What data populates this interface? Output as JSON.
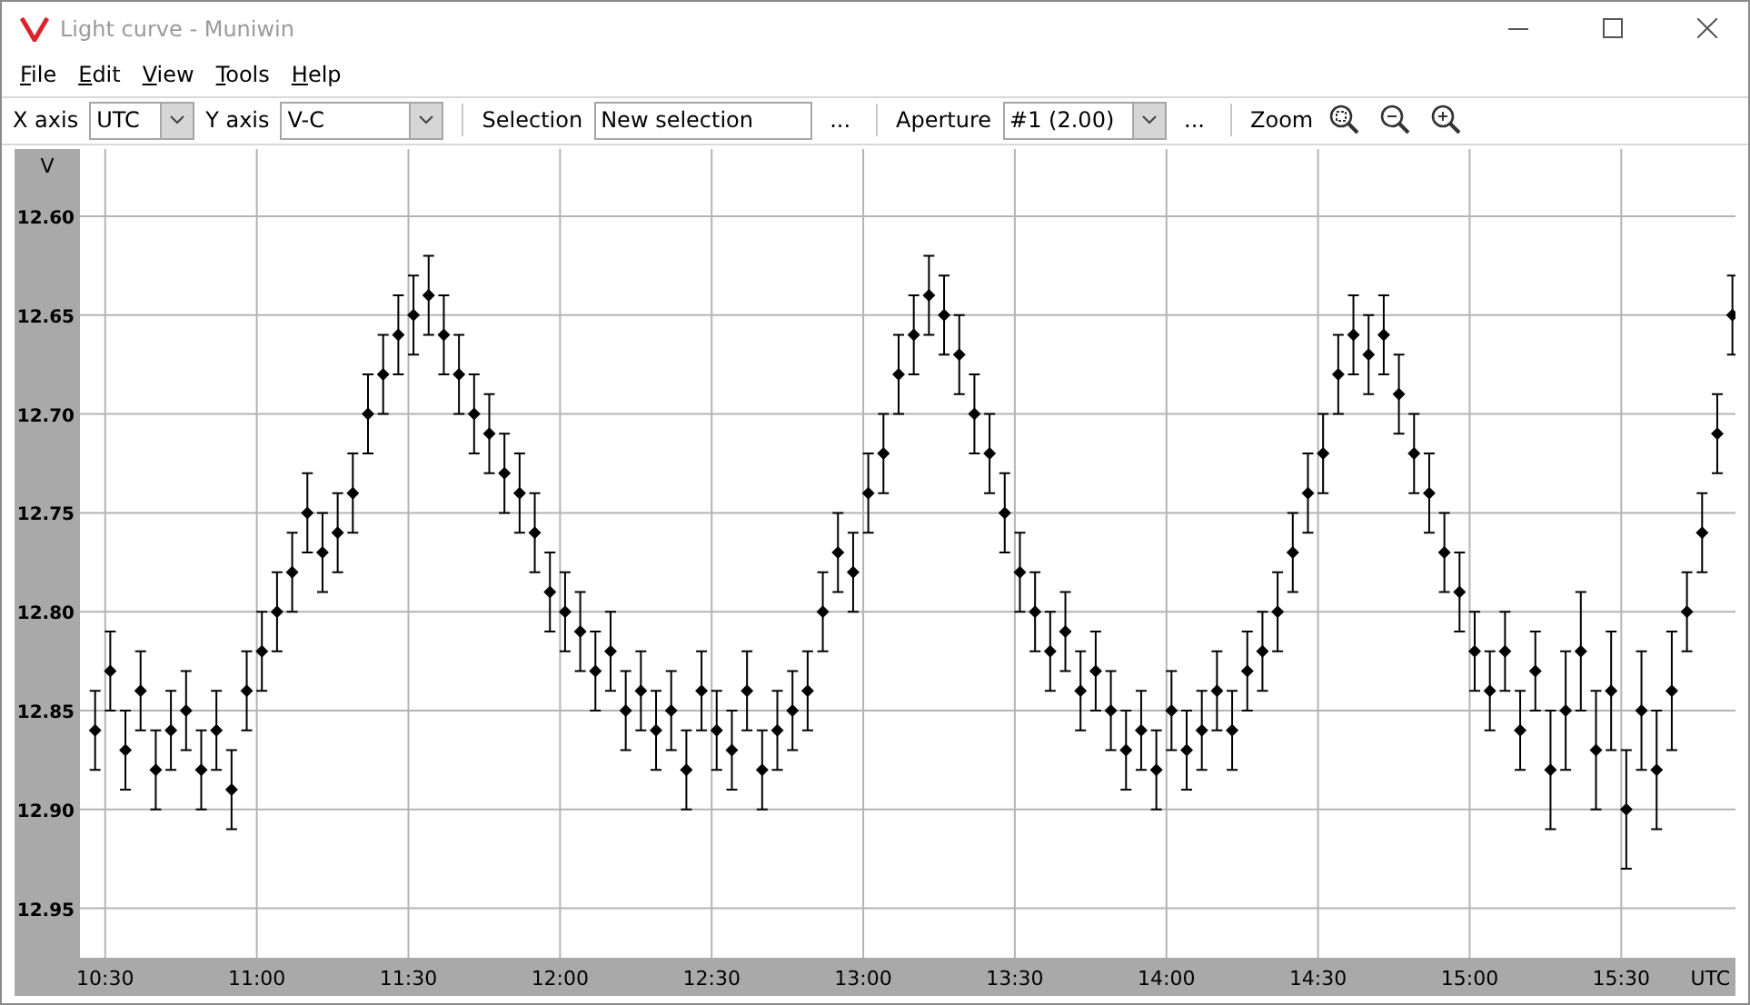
{
  "window": {
    "title": "Light curve - Muniwin"
  },
  "menu": [
    {
      "label": "File"
    },
    {
      "label": "Edit"
    },
    {
      "label": "View"
    },
    {
      "label": "Tools"
    },
    {
      "label": "Help"
    }
  ],
  "toolbar": {
    "x_axis": {
      "label": "X axis",
      "value": "UTC"
    },
    "y_axis": {
      "label": "Y axis",
      "value": "V-C"
    },
    "selection": {
      "label": "Selection",
      "value": "New selection",
      "more": "..."
    },
    "aperture": {
      "label": "Aperture",
      "value": "#1 (2.00)",
      "more": "..."
    },
    "zoom": {
      "label": "Zoom"
    }
  },
  "chart": {
    "chart_data": {
      "type": "scatter",
      "xlabel": "UTC",
      "ylabel": "V",
      "x": [
        628,
        631,
        634,
        637,
        640,
        643,
        646,
        649,
        652,
        655,
        658,
        661,
        664,
        667,
        670,
        673,
        676,
        679,
        682,
        685,
        688,
        691,
        694,
        697,
        700,
        703,
        706,
        709,
        712,
        715,
        718,
        721,
        724,
        727,
        730,
        733,
        736,
        739,
        742,
        745,
        748,
        751,
        754,
        757,
        760,
        763,
        766,
        769,
        772,
        775,
        778,
        781,
        784,
        787,
        790,
        793,
        796,
        799,
        802,
        805,
        808,
        811,
        814,
        817,
        820,
        823,
        826,
        829,
        832,
        835,
        838,
        841,
        844,
        847,
        850,
        853,
        856,
        859,
        862,
        865,
        868,
        871,
        874,
        877,
        880,
        883,
        886,
        889,
        892,
        895,
        898,
        901,
        904,
        907,
        910,
        913,
        916,
        919,
        922,
        925,
        928,
        931,
        934,
        937,
        940,
        943,
        946,
        949,
        952
      ],
      "grid": true,
      "series": [
        {
          "color": "#000000",
          "errors": [
            0.02,
            0.02,
            0.02,
            0.02,
            0.02,
            0.02,
            0.02,
            0.02,
            0.02,
            0.02,
            0.02,
            0.02,
            0.02,
            0.02,
            0.02,
            0.02,
            0.02,
            0.02,
            0.02,
            0.02,
            0.02,
            0.02,
            0.02,
            0.02,
            0.02,
            0.02,
            0.02,
            0.02,
            0.02,
            0.02,
            0.02,
            0.02,
            0.02,
            0.02,
            0.02,
            0.02,
            0.02,
            0.02,
            0.02,
            0.02,
            0.02,
            0.02,
            0.02,
            0.02,
            0.02,
            0.02,
            0.02,
            0.02,
            0.02,
            0.02,
            0.02,
            0.02,
            0.02,
            0.02,
            0.02,
            0.02,
            0.02,
            0.02,
            0.02,
            0.02,
            0.02,
            0.02,
            0.02,
            0.02,
            0.02,
            0.02,
            0.02,
            0.02,
            0.02,
            0.02,
            0.02,
            0.02,
            0.02,
            0.02,
            0.02,
            0.02,
            0.02,
            0.02,
            0.02,
            0.02,
            0.02,
            0.02,
            0.02,
            0.02,
            0.02,
            0.02,
            0.02,
            0.02,
            0.02,
            0.02,
            0.02,
            0.02,
            0.02,
            0.02,
            0.02,
            0.02,
            0.03,
            0.03,
            0.03,
            0.03,
            0.03,
            0.03,
            0.03,
            0.03,
            0.03,
            0.02,
            0.02,
            0.02,
            0.02
          ],
          "values": [
            12.86,
            12.83,
            12.87,
            12.84,
            12.88,
            12.86,
            12.85,
            12.88,
            12.86,
            12.89,
            12.84,
            12.82,
            12.8,
            12.78,
            12.75,
            12.77,
            12.76,
            12.74,
            12.7,
            12.68,
            12.66,
            12.65,
            12.64,
            12.66,
            12.68,
            12.7,
            12.71,
            12.73,
            12.74,
            12.76,
            12.79,
            12.8,
            12.81,
            12.83,
            12.82,
            12.85,
            12.84,
            12.86,
            12.85,
            12.88,
            12.84,
            12.86,
            12.87,
            12.84,
            12.88,
            12.86,
            12.85,
            12.84,
            12.8,
            12.77,
            12.78,
            12.74,
            12.72,
            12.68,
            12.66,
            12.64,
            12.65,
            12.67,
            12.7,
            12.72,
            12.75,
            12.78,
            12.8,
            12.82,
            12.81,
            12.84,
            12.83,
            12.85,
            12.87,
            12.86,
            12.88,
            12.85,
            12.87,
            12.86,
            12.84,
            12.86,
            12.83,
            12.82,
            12.8,
            12.77,
            12.74,
            12.72,
            12.68,
            12.66,
            12.67,
            12.66,
            12.69,
            12.72,
            12.74,
            12.77,
            12.79,
            12.82,
            12.84,
            12.82,
            12.86,
            12.83,
            12.88,
            12.85,
            12.82,
            12.87,
            12.84,
            12.9,
            12.85,
            12.88,
            12.84,
            12.8,
            12.76,
            12.71,
            12.65
          ]
        }
      ],
      "xlim": [
        625,
        952.6
      ],
      "ylim": [
        12.975,
        12.566
      ],
      "xticks": [
        {
          "value": 630,
          "label": "10:30"
        },
        {
          "value": 660,
          "label": "11:00"
        },
        {
          "value": 690,
          "label": "11:30"
        },
        {
          "value": 720,
          "label": "12:00"
        },
        {
          "value": 750,
          "label": "12:30"
        },
        {
          "value": 780,
          "label": "13:00"
        },
        {
          "value": 810,
          "label": "13:30"
        },
        {
          "value": 840,
          "label": "14:00"
        },
        {
          "value": 870,
          "label": "14:30"
        },
        {
          "value": 900,
          "label": "15:00"
        },
        {
          "value": 930,
          "label": "15:30"
        }
      ],
      "yticks": [
        {
          "value": 12.6,
          "label": "12.60"
        },
        {
          "value": 12.65,
          "label": "12.65"
        },
        {
          "value": 12.7,
          "label": "12.70"
        },
        {
          "value": 12.75,
          "label": "12.75"
        },
        {
          "value": 12.8,
          "label": "12.80"
        },
        {
          "value": 12.85,
          "label": "12.85"
        },
        {
          "value": 12.9,
          "label": "12.90"
        },
        {
          "value": 12.95,
          "label": "12.95"
        }
      ]
    }
  }
}
